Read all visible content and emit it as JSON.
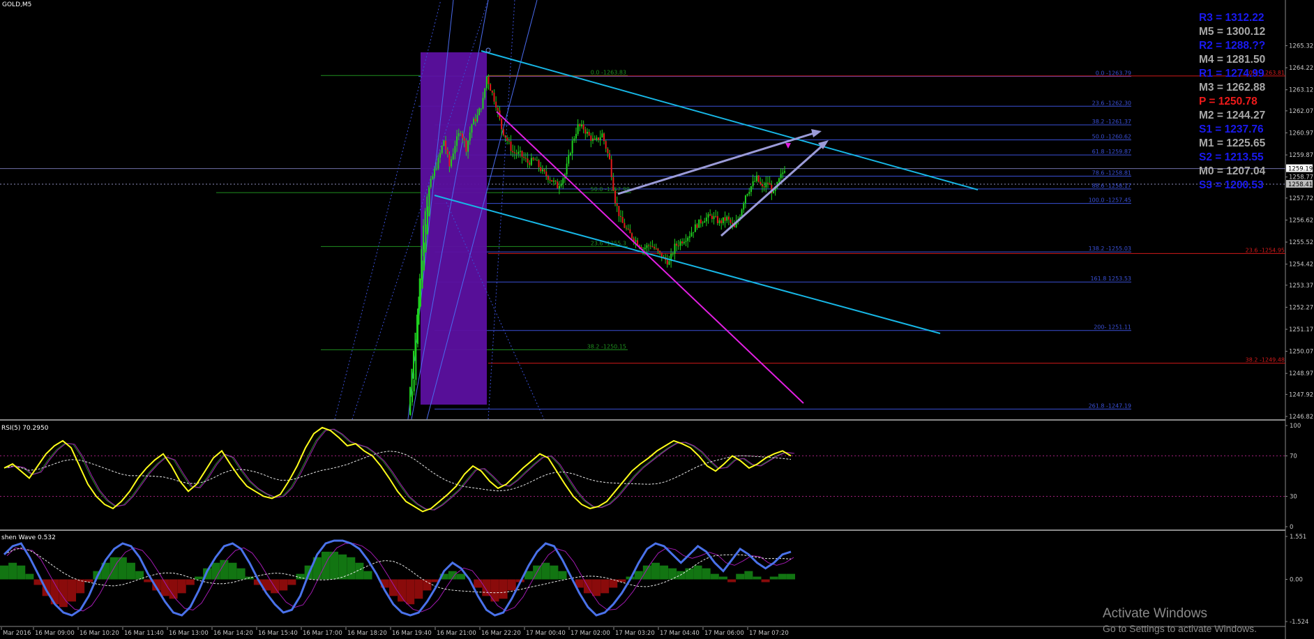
{
  "symbol": "GOLD,M5",
  "colors": {
    "background": "#000000",
    "candle_up": "#1fd11f",
    "candle_down": "#e31a1a",
    "wick": "#1fd11f",
    "channel": "#17b7e6",
    "trendline": "#e21fe2",
    "wedge": "#9b9bd8",
    "box": "#5c10a0",
    "fib_blue": "#3a50d6",
    "fib_green": "#1f8f1f",
    "fib_red": "#d01a1a",
    "rsi": "#ffff1a",
    "osc_line": "#4a72ea",
    "hist_up": "#127512",
    "hist_down": "#8a0b0b",
    "pivot_R": "#1a1af0",
    "pivot_M": "#a8a8a8",
    "pivot_P": "#ee1a1a",
    "pivot_S": "#1a1af0"
  },
  "chart_data": [
    {
      "type": "candlestick",
      "name": "GOLD,M5",
      "ylim": [
        1246.82,
        1265.72
      ],
      "y_ticks": [
        "1265.32",
        "1264.22",
        "1263.12",
        "1262.07",
        "1260.97",
        "1259.87",
        "1258.77",
        "1257.72",
        "1256.62",
        "1255.52",
        "1254.42",
        "1253.37",
        "1252.27",
        "1251.17",
        "1250.07",
        "1248.97",
        "1247.92",
        "1246.82"
      ],
      "current_price_labels": [
        "1259.19",
        "1258.41"
      ],
      "price_path": [
        {
          "t": 0,
          "p": 1246.9
        },
        {
          "t": 3,
          "p": 1248.8
        },
        {
          "t": 6,
          "p": 1253.8
        },
        {
          "t": 8,
          "p": 1256.5
        },
        {
          "t": 10,
          "p": 1257.9
        },
        {
          "t": 13,
          "p": 1258.8
        },
        {
          "t": 16,
          "p": 1259.6
        },
        {
          "t": 19,
          "p": 1260.6
        },
        {
          "t": 22,
          "p": 1259.3
        },
        {
          "t": 25,
          "p": 1260.4
        },
        {
          "t": 28,
          "p": 1261.1
        },
        {
          "t": 31,
          "p": 1260.2
        },
        {
          "t": 34,
          "p": 1261.4
        },
        {
          "t": 37,
          "p": 1261.8
        },
        {
          "t": 40,
          "p": 1262.6
        },
        {
          "t": 42,
          "p": 1263.79
        },
        {
          "t": 44,
          "p": 1263.2
        },
        {
          "t": 47,
          "p": 1262.4
        },
        {
          "t": 50,
          "p": 1261.2
        },
        {
          "t": 53,
          "p": 1260.6
        },
        {
          "t": 56,
          "p": 1260.0
        },
        {
          "t": 60,
          "p": 1259.9
        },
        {
          "t": 64,
          "p": 1259.5
        },
        {
          "t": 68,
          "p": 1259.6
        },
        {
          "t": 72,
          "p": 1259.0
        },
        {
          "t": 76,
          "p": 1258.7
        },
        {
          "t": 80,
          "p": 1258.3
        },
        {
          "t": 84,
          "p": 1258.9
        },
        {
          "t": 88,
          "p": 1260.5
        },
        {
          "t": 91,
          "p": 1261.3
        },
        {
          "t": 94,
          "p": 1261.2
        },
        {
          "t": 97,
          "p": 1260.8
        },
        {
          "t": 100,
          "p": 1260.5
        },
        {
          "t": 104,
          "p": 1260.9
        },
        {
          "t": 108,
          "p": 1259.6
        },
        {
          "t": 111,
          "p": 1257.6
        },
        {
          "t": 114,
          "p": 1256.6
        },
        {
          "t": 118,
          "p": 1256.0
        },
        {
          "t": 122,
          "p": 1255.6
        },
        {
          "t": 126,
          "p": 1255.2
        },
        {
          "t": 130,
          "p": 1255.4
        },
        {
          "t": 134,
          "p": 1255.0
        },
        {
          "t": 137,
          "p": 1254.7
        },
        {
          "t": 140,
          "p": 1254.5
        },
        {
          "t": 143,
          "p": 1255.3
        },
        {
          "t": 147,
          "p": 1255.6
        },
        {
          "t": 151,
          "p": 1255.9
        },
        {
          "t": 155,
          "p": 1256.4
        },
        {
          "t": 159,
          "p": 1256.7
        },
        {
          "t": 163,
          "p": 1256.8
        },
        {
          "t": 167,
          "p": 1256.5
        },
        {
          "t": 171,
          "p": 1256.7
        },
        {
          "t": 175,
          "p": 1256.2
        },
        {
          "t": 178,
          "p": 1256.9
        },
        {
          "t": 181,
          "p": 1257.9
        },
        {
          "t": 184,
          "p": 1258.3
        },
        {
          "t": 187,
          "p": 1258.7
        },
        {
          "t": 190,
          "p": 1258.2
        },
        {
          "t": 193,
          "p": 1258.5
        },
        {
          "t": 196,
          "p": 1257.9
        },
        {
          "t": 199,
          "p": 1258.6
        },
        {
          "t": 202,
          "p": 1259.2
        }
      ],
      "fib_right": [
        {
          "label": "0.0 -1263.79",
          "p": 1263.79
        },
        {
          "label": "23.6 -1262.30",
          "p": 1262.3
        },
        {
          "label": "38.2 -1261.37",
          "p": 1261.37
        },
        {
          "label": "50.0 -1260.62",
          "p": 1260.62
        },
        {
          "label": "61.8 -1259.87",
          "p": 1259.87
        },
        {
          "label": "78.6 -1258.81",
          "p": 1258.81
        },
        {
          "label": "88.6 -1258.17",
          "p": 1258.17
        },
        {
          "label": "100.0 -1257.45",
          "p": 1257.45
        },
        {
          "label": "138.2 -1255.03",
          "p": 1255.03
        },
        {
          "label": "161.8 1253.53",
          "p": 1253.53
        },
        {
          "label": "200- 1251.11",
          "p": 1251.11
        },
        {
          "label": "261.8 -1247.19",
          "p": 1247.19
        }
      ],
      "fib_green": [
        {
          "label": "0.0 -1263.83",
          "p": 1263.83
        },
        {
          "label": "50.0 -1257.99",
          "p": 1257.99
        },
        {
          "label": "23.6 -1255.3",
          "p": 1255.3
        },
        {
          "label": "38.2 -1250.15",
          "p": 1250.15
        }
      ],
      "fib_red": [
        {
          "label": "0.0 -1263.81",
          "p": 1263.81
        },
        {
          "label": "23.6 -1254.95",
          "p": 1254.95
        },
        {
          "label": "38.2 -1249.48",
          "p": 1249.48
        }
      ]
    },
    {
      "type": "line",
      "name": "RSI",
      "label": "RSI(5) 70.2950",
      "ylim": [
        0,
        100
      ],
      "y_ticks": [
        "100",
        "70",
        "30",
        "0"
      ],
      "levels": [
        70,
        30
      ],
      "values": [
        58,
        62,
        55,
        48,
        60,
        72,
        80,
        85,
        78,
        60,
        42,
        30,
        22,
        18,
        25,
        35,
        48,
        58,
        66,
        72,
        60,
        45,
        35,
        42,
        55,
        68,
        75,
        62,
        50,
        40,
        35,
        30,
        28,
        32,
        45,
        60,
        78,
        92,
        98,
        95,
        88,
        80,
        82,
        75,
        70,
        60,
        48,
        35,
        25,
        20,
        15,
        18,
        25,
        32,
        40,
        52,
        60,
        55,
        45,
        38,
        42,
        50,
        58,
        65,
        72,
        68,
        55,
        42,
        30,
        22,
        18,
        20,
        25,
        35,
        45,
        55,
        62,
        68,
        75,
        80,
        85,
        82,
        78,
        70,
        60,
        55,
        62,
        70,
        65,
        58,
        62,
        68,
        72,
        75,
        70
      ]
    },
    {
      "type": "line",
      "name": "Oscillator",
      "label": "shen Wave 0.532",
      "ylim": [
        -1.524,
        1.551
      ],
      "y_ticks": [
        "1.551",
        "0.00",
        "-1.524"
      ],
      "values": [
        0.9,
        1.2,
        1.3,
        0.8,
        0.2,
        -0.4,
        -0.9,
        -1.2,
        -1.3,
        -1.1,
        -0.6,
        0.1,
        0.7,
        1.1,
        1.3,
        1.2,
        0.8,
        0.2,
        -0.3,
        -0.8,
        -1.2,
        -1.3,
        -1.0,
        -0.4,
        0.3,
        0.8,
        1.2,
        1.3,
        1.1,
        0.6,
        0.0,
        -0.5,
        -0.9,
        -1.2,
        -1.1,
        -0.6,
        0.2,
        0.9,
        1.3,
        1.4,
        1.4,
        1.3,
        1.1,
        0.7,
        0.2,
        -0.4,
        -0.9,
        -1.2,
        -1.3,
        -1.2,
        -0.8,
        -0.3,
        0.3,
        0.6,
        0.4,
        0.0,
        -0.6,
        -1.1,
        -1.3,
        -1.2,
        -0.7,
        -0.1,
        0.5,
        1.0,
        1.3,
        1.2,
        0.7,
        0.1,
        -0.5,
        -1.0,
        -1.3,
        -1.2,
        -0.9,
        -0.5,
        0.0,
        0.6,
        1.1,
        1.3,
        1.2,
        0.9,
        0.6,
        0.9,
        1.2,
        1.0,
        0.6,
        0.3,
        0.7,
        1.1,
        0.9,
        0.6,
        0.4,
        0.6,
        0.9,
        1.0
      ],
      "histogram": [
        0.5,
        0.6,
        0.5,
        0.2,
        -0.2,
        -0.6,
        -0.9,
        -1.0,
        -0.8,
        -0.5,
        -0.1,
        0.3,
        0.6,
        0.8,
        0.8,
        0.6,
        0.3,
        -0.1,
        -0.4,
        -0.6,
        -0.7,
        -0.5,
        -0.2,
        0.1,
        0.4,
        0.6,
        0.7,
        0.6,
        0.4,
        0.1,
        -0.2,
        -0.4,
        -0.5,
        -0.4,
        -0.2,
        0.2,
        0.5,
        0.8,
        1.0,
        1.0,
        0.9,
        0.8,
        0.6,
        0.3,
        0.0,
        -0.3,
        -0.6,
        -0.8,
        -0.9,
        -0.7,
        -0.4,
        -0.1,
        0.2,
        0.3,
        0.2,
        0.0,
        -0.3,
        -0.6,
        -0.8,
        -0.7,
        -0.4,
        -0.1,
        0.3,
        0.5,
        0.6,
        0.5,
        0.3,
        0.0,
        -0.3,
        -0.5,
        -0.6,
        -0.5,
        -0.3,
        -0.1,
        0.1,
        0.3,
        0.5,
        0.6,
        0.5,
        0.4,
        0.3,
        0.4,
        0.5,
        0.4,
        0.2,
        0.1,
        -0.1,
        0.2,
        0.3,
        0.1,
        -0.1,
        0.1,
        0.2,
        0.2
      ]
    }
  ],
  "time_axis": [
    "Mar 2016",
    "16 Mar 09:00",
    "16 Mar 10:20",
    "16 Mar 11:40",
    "16 Mar 13:00",
    "16 Mar 14:20",
    "16 Mar 15:40",
    "16 Mar 17:00",
    "16 Mar 18:20",
    "16 Mar 19:40",
    "16 Mar 21:00",
    "16 Mar 22:20",
    "17 Mar 00:40",
    "17 Mar 02:00",
    "17 Mar 03:20",
    "17 Mar 04:40",
    "17 Mar 06:00",
    "17 Mar 07:20"
  ],
  "pivots": [
    {
      "label": "R3 = 1312.22",
      "kind": "R"
    },
    {
      "label": "M5 = 1300.12",
      "kind": "M"
    },
    {
      "label": "R2 = 1288.??",
      "kind": "R"
    },
    {
      "label": "M4 = 1281.50",
      "kind": "M"
    },
    {
      "label": "R1 = 1274.99",
      "kind": "R"
    },
    {
      "label": "M3 = 1262.88",
      "kind": "M"
    },
    {
      "label": "P  = 1250.78",
      "kind": "P"
    },
    {
      "label": "M2 = 1244.27",
      "kind": "M"
    },
    {
      "label": "S1 = 1237.76",
      "kind": "S"
    },
    {
      "label": "M1 = 1225.65",
      "kind": "M"
    },
    {
      "label": "S2 = 1213.55",
      "kind": "S"
    },
    {
      "label": "M0 = 1207.04",
      "kind": "M"
    },
    {
      "label": "S3 = 1200.53",
      "kind": "S"
    }
  ],
  "watermark": {
    "title": "Activate Windows",
    "subtitle": "Go to Settings to activate Windows."
  }
}
